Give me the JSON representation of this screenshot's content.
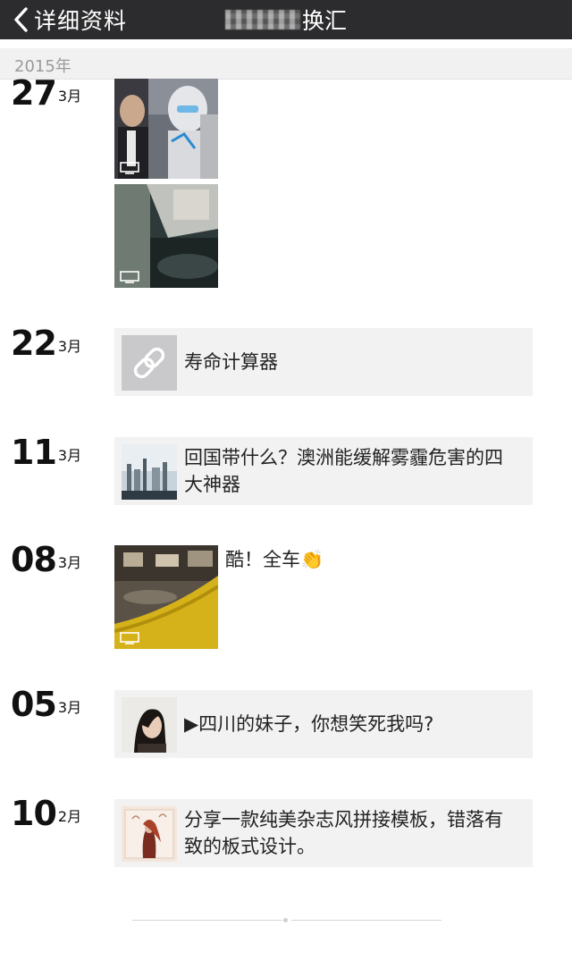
{
  "nav": {
    "back_label": "详细资料",
    "title_visible": "换汇"
  },
  "year_header": "2015年",
  "entries": [
    {
      "day": "27",
      "month": "3月",
      "type": "videos",
      "count": 2
    },
    {
      "day": "22",
      "month": "3月",
      "type": "link",
      "text": "寿命计算器",
      "icon": "link-icon"
    },
    {
      "day": "11",
      "month": "3月",
      "type": "link",
      "text": "回国带什么？澳洲能缓解雾霾危害的四大神器"
    },
    {
      "day": "08",
      "month": "3月",
      "type": "video-post",
      "text": "酷！全车👏"
    },
    {
      "day": "05",
      "month": "3月",
      "type": "link",
      "text": "▶四川的妹子，你想笑死我吗?"
    },
    {
      "day": "10",
      "month": "2月",
      "type": "link",
      "text": "分享一款纯美杂志风拼接模板，错落有致的板式设计。"
    }
  ],
  "colors": {
    "navbar": "#2c2c2e",
    "card_bg": "#f2f2f3",
    "year_text": "#9a9a9a"
  }
}
